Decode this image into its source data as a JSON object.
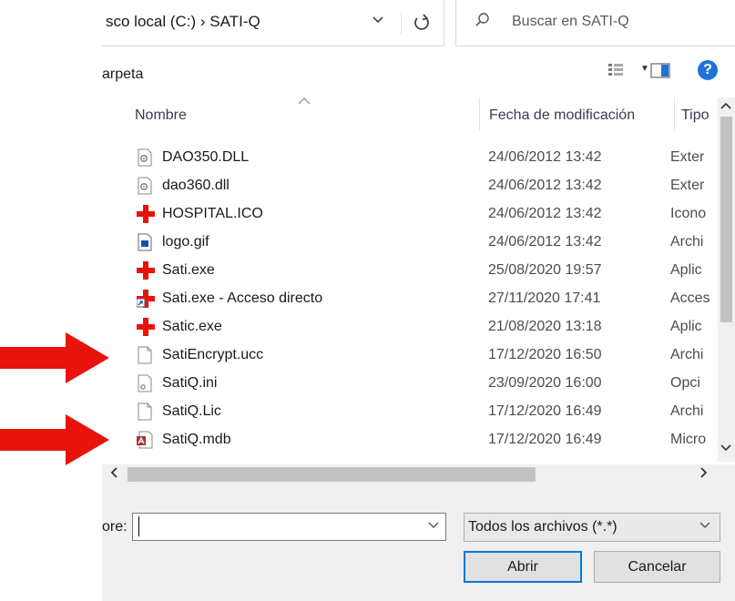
{
  "breadcrumb": {
    "path": "sco local (C:) › SATI-Q",
    "chevron": "⌄"
  },
  "search": {
    "placeholder": "Buscar en SATI-Q"
  },
  "toolbar": {
    "label": "arpeta",
    "help": "?"
  },
  "columns": {
    "name": "Nombre",
    "date": "Fecha de modificación",
    "type": "Tipo"
  },
  "files": [
    {
      "name": "DAO350.DLL",
      "date": "24/06/2012 13:42",
      "type": "Exter",
      "icon": "dll-icon"
    },
    {
      "name": "dao360.dll",
      "date": "24/06/2012 13:42",
      "type": "Exter",
      "icon": "dll-icon"
    },
    {
      "name": "HOSPITAL.ICO",
      "date": "24/06/2012 13:42",
      "type": "Icono",
      "icon": "red-cross-icon"
    },
    {
      "name": "logo.gif",
      "date": "24/06/2012 13:42",
      "type": "Archi",
      "icon": "image-icon"
    },
    {
      "name": "Sati.exe",
      "date": "25/08/2020 19:57",
      "type": "Aplic",
      "icon": "red-cross-icon"
    },
    {
      "name": "Sati.exe - Acceso directo",
      "date": "27/11/2020 17:41",
      "type": "Acces",
      "icon": "shortcut-icon"
    },
    {
      "name": "Satic.exe",
      "date": "21/08/2020 13:18",
      "type": "Aplic",
      "icon": "red-cross-icon"
    },
    {
      "name": "SatiEncrypt.ucc",
      "date": "17/12/2020 16:50",
      "type": "Archi",
      "icon": "blank-file-icon"
    },
    {
      "name": "SatiQ.ini",
      "date": "23/09/2020 16:00",
      "type": "Opci",
      "icon": "ini-icon"
    },
    {
      "name": "SatiQ.Lic",
      "date": "17/12/2020 16:49",
      "type": "Archi",
      "icon": "blank-file-icon"
    },
    {
      "name": "SatiQ.mdb",
      "date": "17/12/2020 16:49",
      "type": "Micro",
      "icon": "access-db-icon"
    }
  ],
  "footer": {
    "filename_label": "ore:",
    "filename_value": "",
    "filetype": "Todos los archivos (*.*)",
    "open_label": "Abrir",
    "cancel_label": "Cancelar"
  },
  "colors": {
    "accent": "#0078d7",
    "arrow": "#e8130c",
    "cross": "#e8130c"
  }
}
